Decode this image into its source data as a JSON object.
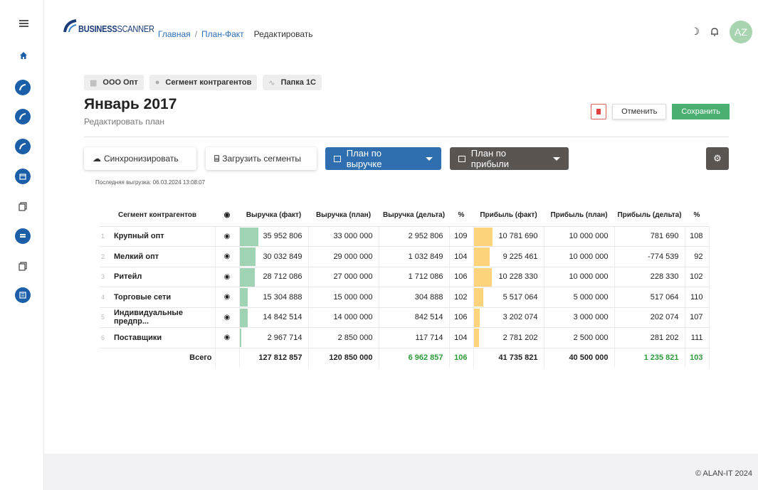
{
  "header": {
    "logo_bold": "BUSINESS",
    "logo_thin": "SCANNER",
    "breadcrumb": [
      "Главная",
      "План-Факт"
    ],
    "breadcrumb_current": "Редактировать",
    "avatar": "AZ"
  },
  "chips": [
    {
      "icon": "building-icon",
      "label": "ООО Опт"
    },
    {
      "icon": "person-icon",
      "label": "Сегмент контрагентов"
    },
    {
      "icon": "trend-icon",
      "label": "Папка 1С"
    }
  ],
  "page": {
    "title": "Январь 2017",
    "subtitle": "Редактировать план",
    "cancel": "Отменить",
    "save": "Сохранить"
  },
  "toolbar": {
    "sync": "Синхронизировать",
    "load_segments": "Загрузить сегменты",
    "plan_revenue": "План по выручке",
    "plan_profit": "План по прибыли",
    "last_upload": "Последняя выгрузка: 06.03.2024 13:08:07"
  },
  "table": {
    "headers": [
      "Сегмент контрагентов",
      "Выручка (факт)",
      "Выручка (план)",
      "Выручка (дельта)",
      "%",
      "Прибыль (факт)",
      "Прибыль (план)",
      "Прибыль (дельта)",
      "%"
    ],
    "rows": [
      {
        "idx": "1",
        "name": "Крупный опт",
        "rev_fact": "35 952 806",
        "rev_plan": "33 000 000",
        "rev_delta": "2 952 806",
        "rev_pct": "109",
        "rev_share": 1.0,
        "prof_fact": "10 781 690",
        "prof_plan": "10 000 000",
        "prof_delta": "781 690",
        "prof_pct": "108",
        "prof_share": 1.0,
        "rev_neg": false,
        "prof_neg": false
      },
      {
        "idx": "2",
        "name": "Мелкий опт",
        "rev_fact": "30 032 849",
        "rev_plan": "29 000 000",
        "rev_delta": "1 032 849",
        "rev_pct": "104",
        "rev_share": 0.84,
        "prof_fact": "9 225 461",
        "prof_plan": "10 000 000",
        "prof_delta": "-774 539",
        "prof_pct": "92",
        "prof_share": 0.86,
        "rev_neg": true,
        "prof_neg": true
      },
      {
        "idx": "3",
        "name": "Ритейл",
        "rev_fact": "28 712 086",
        "rev_plan": "27 000 000",
        "rev_delta": "1 712 086",
        "rev_pct": "106",
        "rev_share": 0.8,
        "prof_fact": "10 228 330",
        "prof_plan": "10 000 000",
        "prof_delta": "228 330",
        "prof_pct": "102",
        "prof_share": 0.95,
        "rev_neg": false,
        "prof_neg": false
      },
      {
        "idx": "4",
        "name": "Торговые сети",
        "rev_fact": "15 304 888",
        "rev_plan": "15 000 000",
        "rev_delta": "304 888",
        "rev_pct": "102",
        "rev_share": 0.43,
        "prof_fact": "5 517 064",
        "prof_plan": "5 000 000",
        "prof_delta": "517 064",
        "prof_pct": "110",
        "prof_share": 0.51,
        "rev_neg": false,
        "prof_neg": false
      },
      {
        "idx": "5",
        "name": "Индивидуальные предпр...",
        "rev_fact": "14 842 514",
        "rev_plan": "14 000 000",
        "rev_delta": "842 514",
        "rev_pct": "106",
        "rev_share": 0.41,
        "prof_fact": "3 202 074",
        "prof_plan": "3 000 000",
        "prof_delta": "202 074",
        "prof_pct": "107",
        "prof_share": 0.3,
        "rev_neg": false,
        "prof_neg": false
      },
      {
        "idx": "6",
        "name": "Поставщики",
        "rev_fact": "2 967 714",
        "rev_plan": "2 850 000",
        "rev_delta": "117 714",
        "rev_pct": "104",
        "rev_share": 0.08,
        "prof_fact": "2 781 202",
        "prof_plan": "2 500 000",
        "prof_delta": "281 202",
        "prof_pct": "111",
        "prof_share": 0.26,
        "rev_neg": false,
        "prof_neg": false
      }
    ],
    "total": {
      "label": "Всего",
      "rev_fact": "127 812 857",
      "rev_plan": "120 850 000",
      "rev_delta": "6 962 857",
      "rev_pct": "106",
      "prof_fact": "41 735 821",
      "prof_plan": "40 500 000",
      "prof_delta": "1 235 821",
      "prof_pct": "103"
    }
  },
  "footer": {
    "copyright": "© ALAN-IT 2024"
  },
  "colors": {
    "revenue_bar": "#9fd3b3",
    "profit_bar": "#fdd37b",
    "positive": "#2e9b3a",
    "negative": "#e04040",
    "save": "#4caf72",
    "primary": "#2f6fb0"
  }
}
